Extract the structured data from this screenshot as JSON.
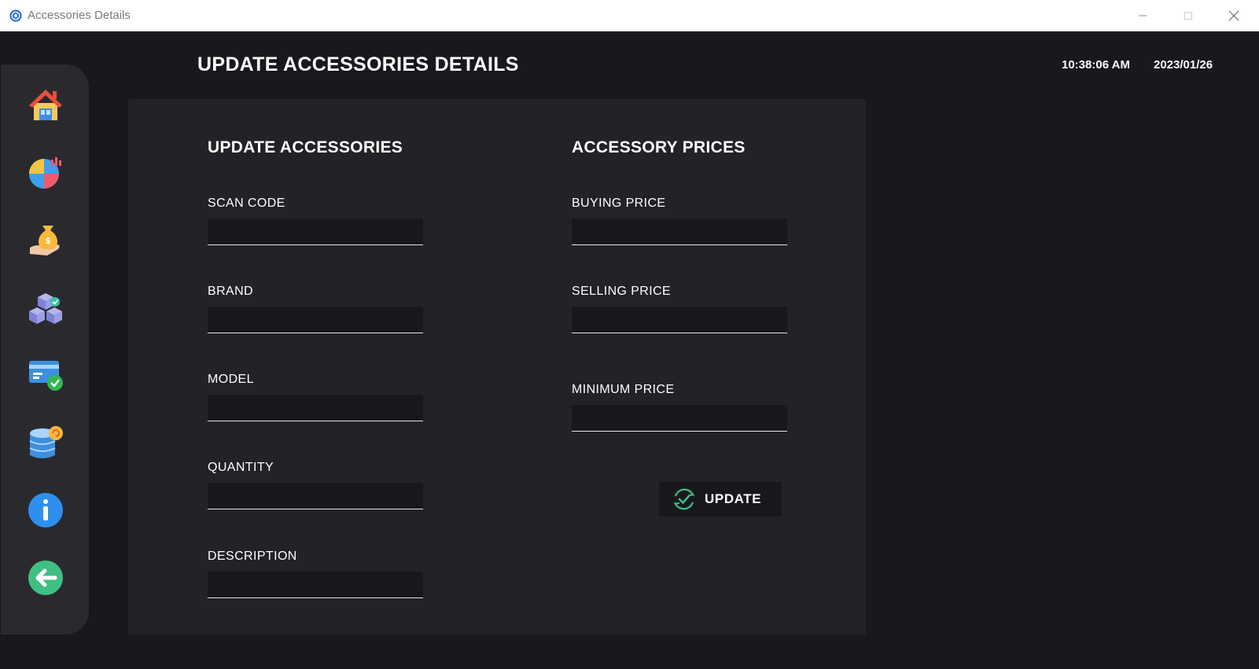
{
  "window": {
    "title": "Accessories Details"
  },
  "header": {
    "page_title": "UPDATE ACCESSORIES DETAILS",
    "time": "10:38:06 AM",
    "date": "2023/01/26"
  },
  "sidebar": {
    "items": [
      {
        "icon": "home-icon"
      },
      {
        "icon": "pie-chart-icon"
      },
      {
        "icon": "money-bag-hand-icon"
      },
      {
        "icon": "boxes-icon"
      },
      {
        "icon": "payment-card-check-icon"
      },
      {
        "icon": "database-refresh-icon"
      },
      {
        "icon": "info-icon"
      },
      {
        "icon": "back-arrow-icon"
      }
    ]
  },
  "form": {
    "left_title": "UPDATE ACCESSORIES",
    "right_title": "ACCESSORY PRICES",
    "scan_code": {
      "label": "SCAN CODE",
      "value": ""
    },
    "brand": {
      "label": "BRAND",
      "value": ""
    },
    "model": {
      "label": "MODEL",
      "value": ""
    },
    "quantity": {
      "label": "QUANTITY",
      "value": ""
    },
    "description": {
      "label": "DESCRIPTION",
      "value": ""
    },
    "buying_price": {
      "label": "BUYING PRICE",
      "value": ""
    },
    "selling_price": {
      "label": "SELLING PRICE",
      "value": ""
    },
    "minimum_price": {
      "label": "MINIMUM PRICE",
      "value": ""
    },
    "update_button": "UPDATE"
  },
  "colors": {
    "background": "#18181d",
    "panel": "#222227",
    "sidebar": "#2a2a2e",
    "accent_green": "#3fbf83",
    "text": "#ffffff"
  }
}
